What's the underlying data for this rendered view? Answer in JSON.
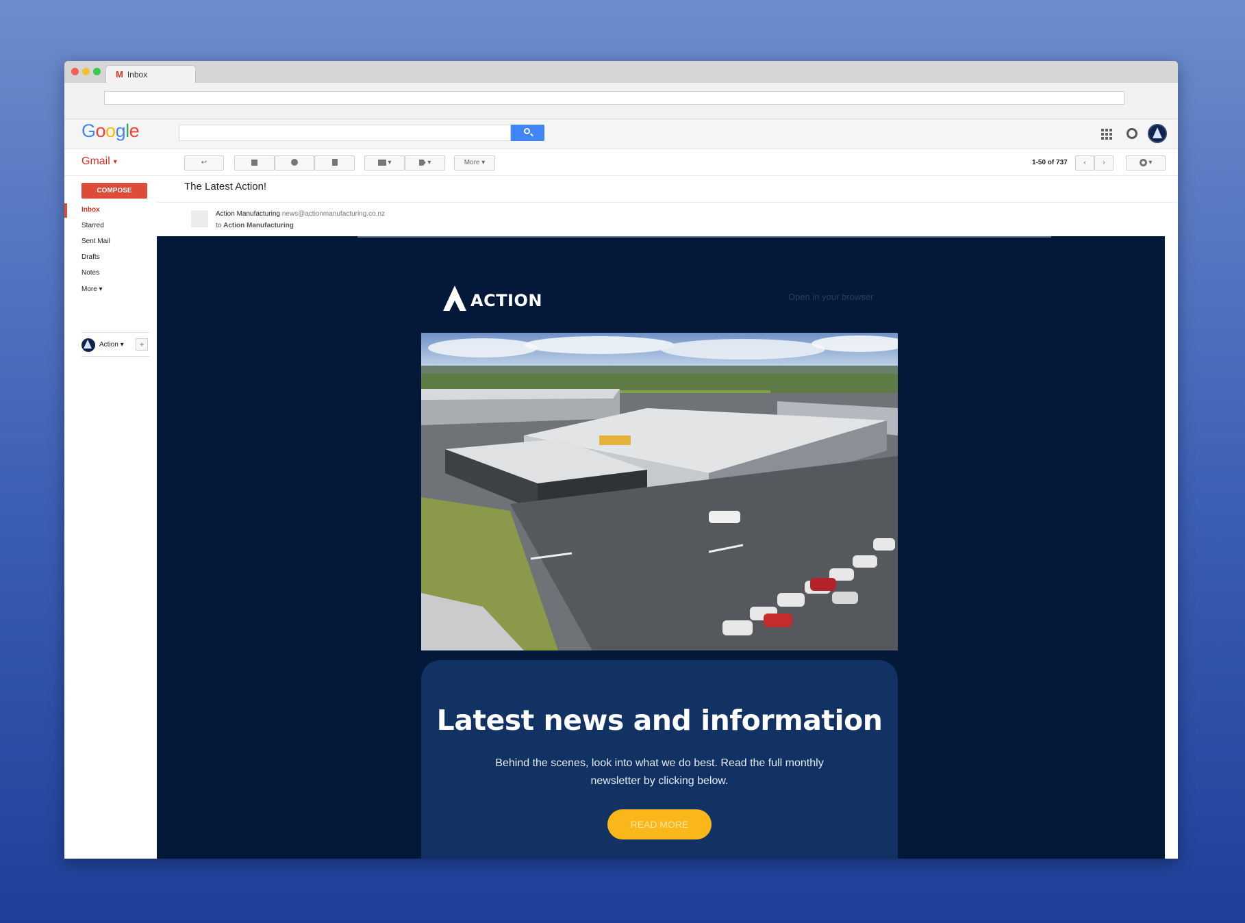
{
  "browser": {
    "tab_title": "Inbox",
    "tab_icon": "gmail-m-icon"
  },
  "header": {
    "logo_letters": [
      "G",
      "o",
      "o",
      "g",
      "l",
      "e"
    ],
    "search_placeholder": ""
  },
  "actionbar": {
    "app_label": "Gmail",
    "more_label": "More",
    "pagination": "1-50 of 737"
  },
  "sidebar": {
    "compose_label": "COMPOSE",
    "items": [
      {
        "label": "Inbox",
        "active": true
      },
      {
        "label": "Starred"
      },
      {
        "label": "Sent Mail"
      },
      {
        "label": "Drafts"
      },
      {
        "label": "Notes"
      },
      {
        "label": "More ▾"
      }
    ],
    "account_label": "Action",
    "add_label": "+"
  },
  "message": {
    "subject": "The Latest Action!",
    "sender_name": "Action Manufacturing",
    "sender_email": "news@actionmanufacturing.co.nz",
    "to_prefix": "to",
    "to_name": "Action Manufacturing"
  },
  "newsletter": {
    "brand": "ACTION",
    "open_in_browser": "Open in your browser",
    "headline": "Latest news and information",
    "body": "Behind the scenes, look into what we do best. Read the full monthly newsletter by clicking below.",
    "cta": "READ MORE",
    "colors": {
      "background": "#041839",
      "card": "#113263",
      "cta": "#f9b71a",
      "compose": "#dd4b39",
      "search_button": "#4285f4"
    }
  }
}
